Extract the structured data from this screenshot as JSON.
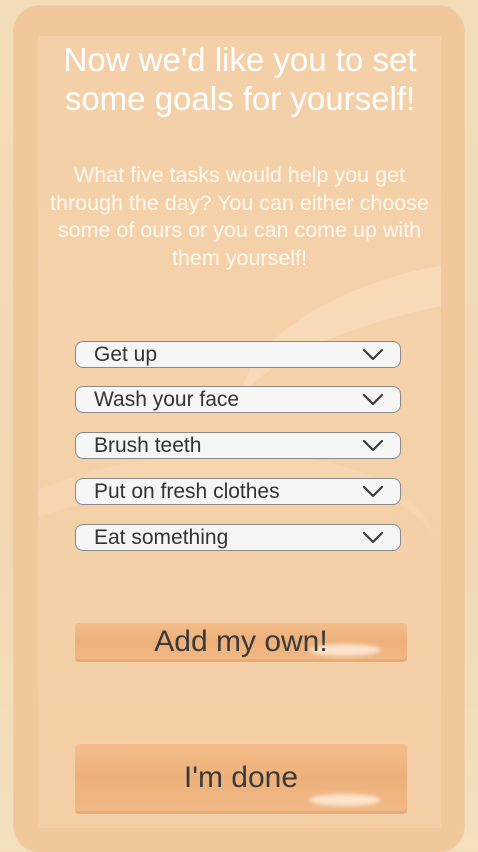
{
  "screen": {
    "title": "Now we'd like you to set some goals for yourself!",
    "subtitle": "What five tasks would help you get through the day? You can either choose some of ours or you can come up with them yourself!"
  },
  "goals": [
    {
      "selected": "Get up"
    },
    {
      "selected": "Wash your face"
    },
    {
      "selected": "Brush teeth"
    },
    {
      "selected": "Put on fresh clothes"
    },
    {
      "selected": "Eat something"
    }
  ],
  "buttons": {
    "add_own": "Add my own!",
    "done": "I'm done"
  },
  "colors": {
    "background": "#f3ddb9",
    "frame": "#f1c89b",
    "panel": "#f4cfa7",
    "button": "#eeb07a",
    "dropdown": "#f6f6f6"
  }
}
